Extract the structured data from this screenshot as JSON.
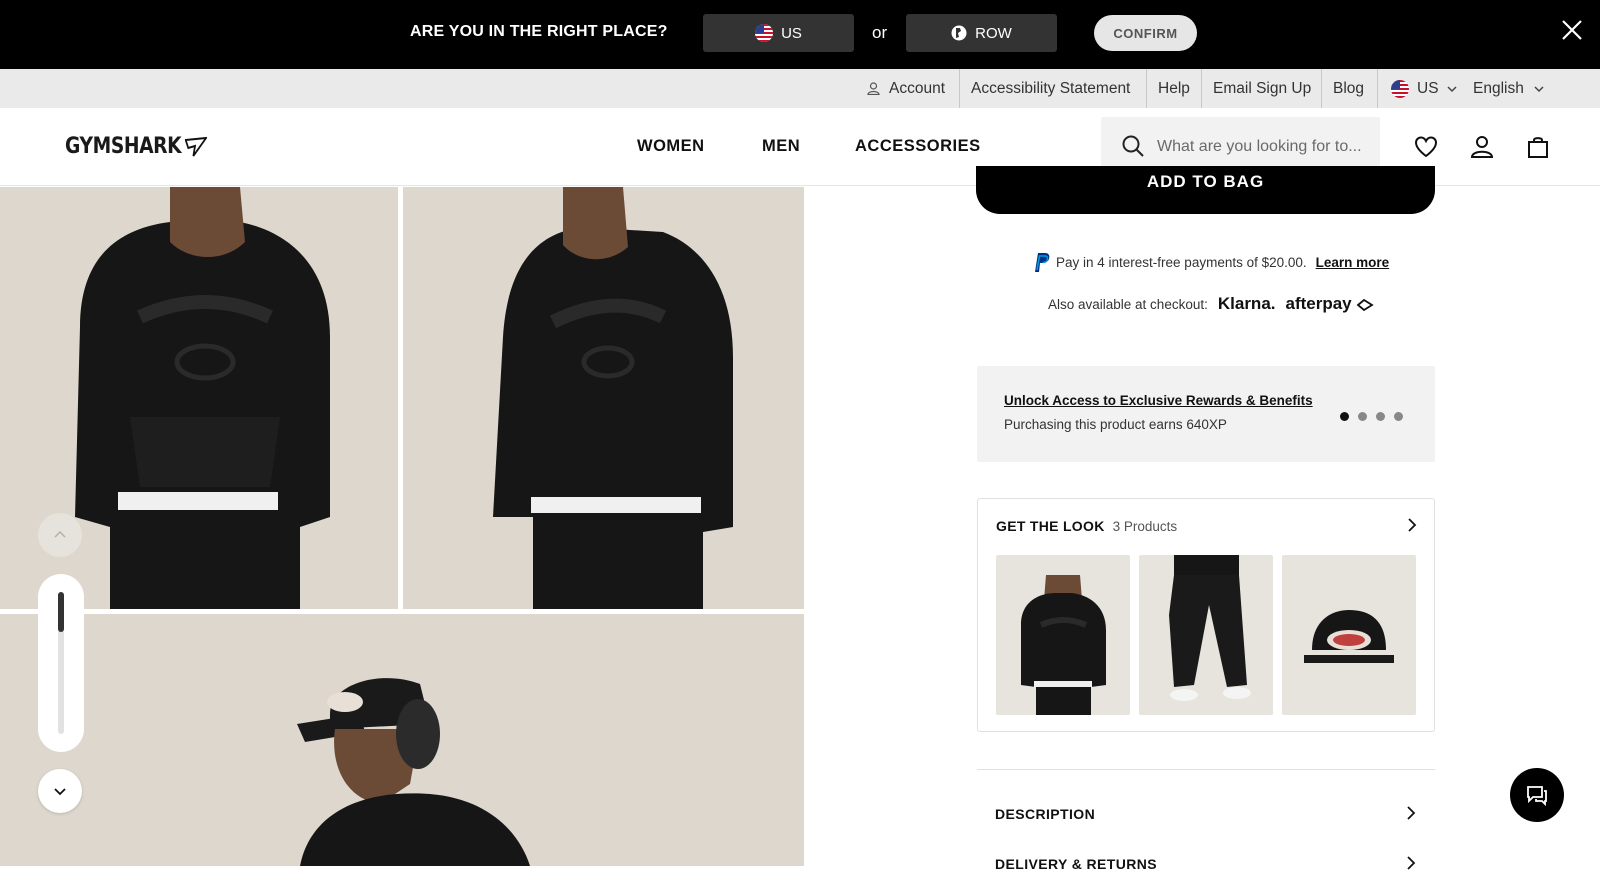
{
  "region_banner": {
    "question": "ARE YOU IN THE RIGHT PLACE?",
    "option_us": "US",
    "or_text": "or",
    "option_row": "ROW",
    "confirm": "CONFIRM"
  },
  "utility_bar": {
    "account": "Account",
    "accessibility": "Accessibility Statement",
    "help": "Help",
    "email_signup": "Email Sign Up",
    "blog": "Blog",
    "country": "US",
    "language": "English"
  },
  "header": {
    "logo": "GYMSHARK",
    "nav": [
      "WOMEN",
      "MEN",
      "ACCESSORIES"
    ],
    "search_placeholder": "What are you looking for to..."
  },
  "product": {
    "add_to_bag": "ADD TO BAG",
    "paypal_text": "Pay in 4 interest-free payments of $20.00.",
    "paypal_link": "Learn more",
    "also_available": "Also available at checkout:",
    "klarna": "Klarna.",
    "afterpay": "afterpay"
  },
  "rewards": {
    "title": "Unlock Access to Exclusive Rewards & Benefits",
    "subtitle": "Purchasing this product earns 640XP",
    "dots_total": 4,
    "active_dot": 1
  },
  "get_the_look": {
    "title": "GET THE LOOK",
    "count": "3 Products"
  },
  "accordion": {
    "description": "DESCRIPTION",
    "delivery": "DELIVERY & RETURNS"
  },
  "colors": {
    "banner_bg": "#000000",
    "photo_bg": "#ddd7cd",
    "accent": "#111111"
  }
}
